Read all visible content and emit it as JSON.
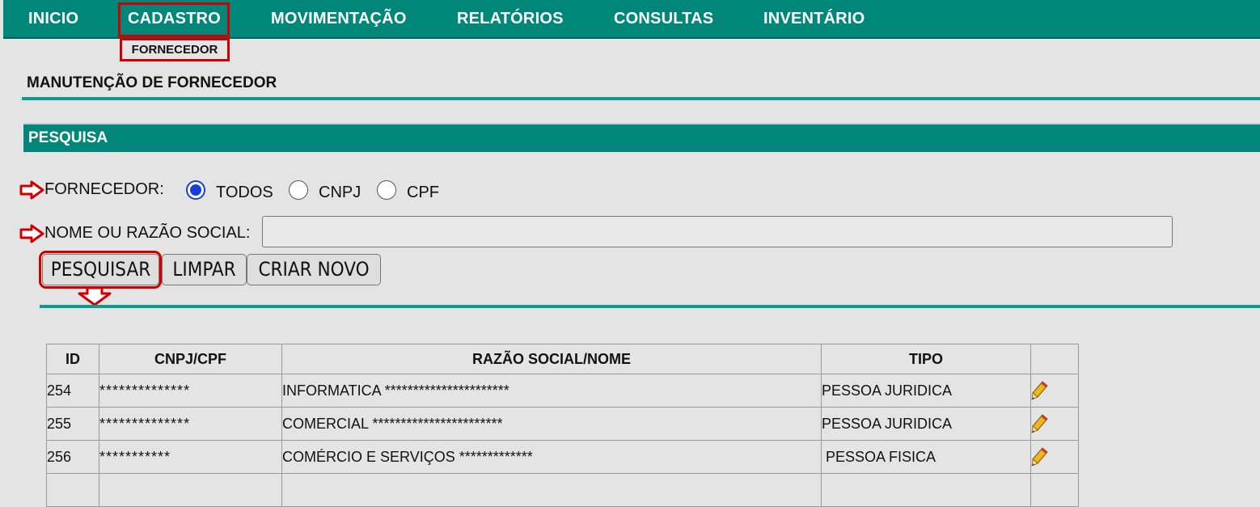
{
  "nav": {
    "items": [
      "INICIO",
      "CADASTRO",
      "MOVIMENTAÇÃO",
      "RELATÓRIOS",
      "CONSULTAS",
      "INVENTÁRIO"
    ],
    "submenu_label": "FORNECEDOR"
  },
  "page_title": "MANUTENÇÃO DE FORNECEDOR",
  "search": {
    "section_title": "PESQUISA",
    "fornecedor_label": "FORNECEDOR:",
    "radio_options": [
      "TODOS",
      "CNPJ",
      "CPF"
    ],
    "radio_selected": "TODOS",
    "nome_label": "NOME OU RAZÃO SOCIAL:",
    "nome_value": "",
    "buttons": [
      "PESQUISAR",
      "LIMPAR",
      "CRIAR NOVO"
    ]
  },
  "table": {
    "headers": [
      "ID",
      "CNPJ/CPF",
      "RAZÃO SOCIAL/NOME",
      "TIPO",
      ""
    ],
    "rows": [
      {
        "id": "254",
        "doc": "**************",
        "nome": "INFORMATICA **********************",
        "tipo": "PESSOA JURIDICA"
      },
      {
        "id": "255",
        "doc": "**************",
        "nome": "COMERCIAL ***********************",
        "tipo": "PESSOA JURIDICA"
      },
      {
        "id": "256",
        "doc": "***********",
        "nome": "COMÉRCIO E SERVIÇOS *************",
        "tipo": " PESSOA FISICA"
      }
    ],
    "row_action_icon": "pencil-icon"
  },
  "colors": {
    "nav_bg": "#00877a",
    "rule": "#0e9b8f",
    "highlight": "#d00000",
    "radio_selected": "#1340d8",
    "page_bg": "#e4e4e4"
  }
}
